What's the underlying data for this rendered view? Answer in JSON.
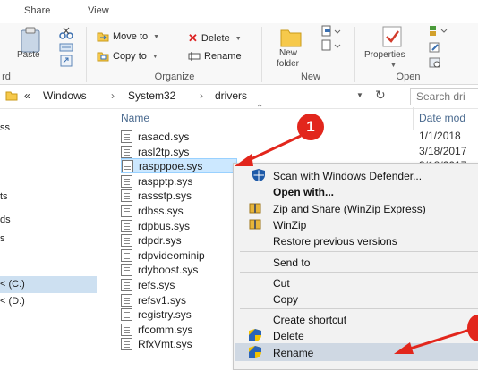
{
  "ribbon_tabs": [
    "Share",
    "View"
  ],
  "ribbon": {
    "clipboard": {
      "paste": "Paste",
      "group_tail": "rd"
    },
    "organize": {
      "move_to": "Move to",
      "copy_to": "Copy to",
      "delete": "Delete",
      "rename": "Rename",
      "label": "Organize"
    },
    "new": {
      "new_folder_line1": "New",
      "new_folder_line2": "folder",
      "label": "New"
    },
    "open": {
      "properties": "Properties",
      "label": "Open"
    }
  },
  "address": {
    "crumbs": [
      "«",
      "Windows",
      "System32",
      "drivers"
    ],
    "separator": "›",
    "search_placeholder": "Search dri"
  },
  "nav_pane": [
    "ss",
    "ts",
    "ds",
    "s",
    "< (C:)",
    "< (D:)"
  ],
  "file_list": {
    "columns": {
      "name": "Name",
      "date": "Date mod"
    },
    "files": [
      {
        "name": "rasacd.sys",
        "date": "1/1/2018"
      },
      {
        "name": "rasl2tp.sys",
        "date": "3/18/2017"
      },
      {
        "name": "raspppoe.sys",
        "date": "3/18/2017"
      },
      {
        "name": "raspptp.sys",
        "date": ""
      },
      {
        "name": "rassstp.sys",
        "date": ""
      },
      {
        "name": "rdbss.sys",
        "date": ""
      },
      {
        "name": "rdpbus.sys",
        "date": ""
      },
      {
        "name": "rdpdr.sys",
        "date": ""
      },
      {
        "name": "rdpvideominip",
        "date": ""
      },
      {
        "name": "rdyboost.sys",
        "date": ""
      },
      {
        "name": "refs.sys",
        "date": ""
      },
      {
        "name": "refsv1.sys",
        "date": ""
      },
      {
        "name": "registry.sys",
        "date": ""
      },
      {
        "name": "rfcomm.sys",
        "date": ""
      },
      {
        "name": "RfxVmt.sys",
        "date": ""
      }
    ],
    "selected_index": 2
  },
  "context_menu": {
    "items": [
      "Scan with Windows Defender...",
      "Open with...",
      "Zip and Share (WinZip Express)",
      "WinZip",
      "Restore previous versions",
      "Send to",
      "Cut",
      "Copy",
      "Create shortcut",
      "Delete",
      "Rename"
    ],
    "highlighted": "Rename"
  },
  "annotation": {
    "badge": "1"
  },
  "colors": {
    "accent": "#0078d7",
    "annotation_red": "#e2261c",
    "selection": "#cce8ff"
  }
}
